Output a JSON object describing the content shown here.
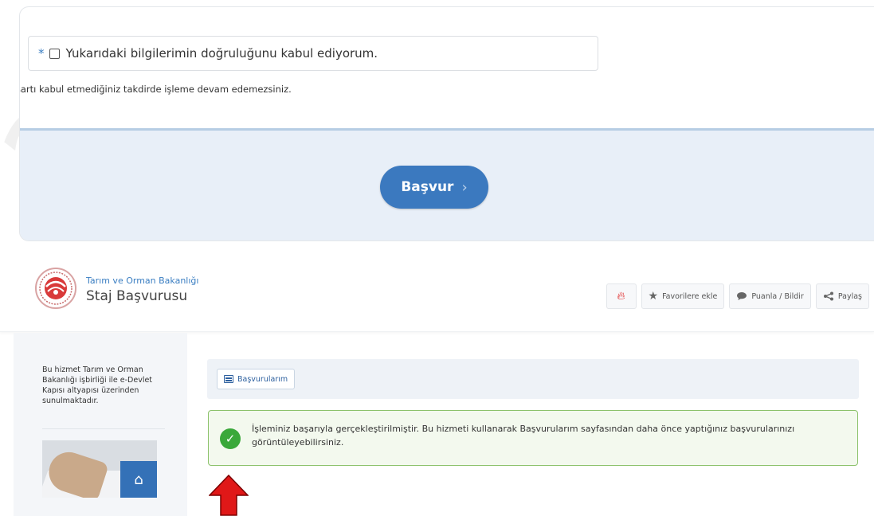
{
  "form": {
    "required_marker": "*",
    "consent_label": "Yukarıdaki bilgilerimin doğruluğunu kabul ediyorum.",
    "consent_checked": false,
    "consent_note": "Bu şartı kabul etmediğiniz takdirde işleme devam edemezsiniz.",
    "apply_label": "Başvur",
    "apply_chevron": "›"
  },
  "header": {
    "ministry_name": "Tarım ve Orman Bakanlığı",
    "service_title": "Staj Başvurusu",
    "actions": {
      "favorite_label": "Favorilere ekle",
      "rate_label": "Puanla / Bildir",
      "share_label": "Paylaş"
    }
  },
  "sidebar": {
    "info_text": "Bu hizmet Tarım ve Orman Bakanlığı işbirliği ile e-Devlet Kapısı altyapısı üzerinden sunulmaktadır."
  },
  "main": {
    "tab_label": "Başvurularım",
    "success_message": "İşleminiz başarıyla gerçekleştirilmiştir. Bu hizmeti kullanarak Başvurularım sayfasından daha önce yaptığınız başvurularınızı görüntüleyebilirsiniz."
  },
  "colors": {
    "primary": "#3b79bf",
    "success_border": "#8cc26b",
    "success_icon": "#3aa83a",
    "annotation_arrow": "#e01818"
  },
  "icons": {
    "flame": "flame-icon",
    "star": "star-icon",
    "comment": "comment-icon",
    "share": "share-icon",
    "list": "list-icon",
    "check": "check-circle-icon"
  }
}
